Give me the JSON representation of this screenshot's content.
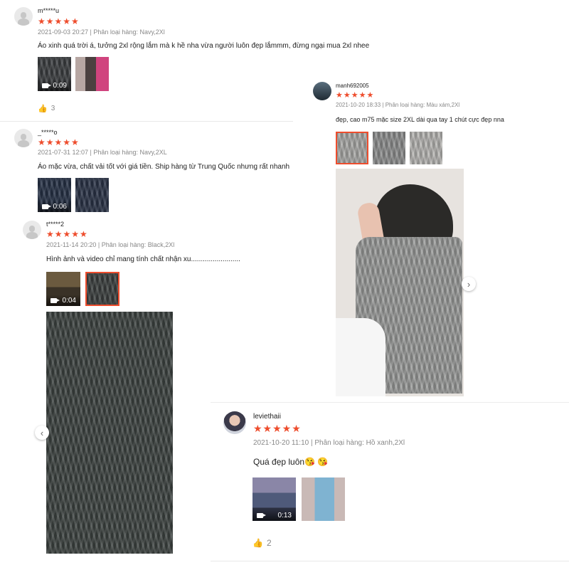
{
  "reviews": [
    {
      "username": "m*****u",
      "stars": "★★★★★",
      "meta": "2021-09-03 20:27 | Phân loại hàng: Navy,2Xl",
      "content": "Áo xinh quá trời á, tưởng 2xl rộng lắm mà k hề nha vừa người luôn đẹp lắmmm, đừng ngại mua 2xl nhee",
      "media": [
        {
          "type": "video",
          "duration": "0:09"
        },
        {
          "type": "image"
        }
      ],
      "likes": "3"
    },
    {
      "username": "_*****o",
      "stars": "★★★★★",
      "meta": "2021-07-31 12:07 | Phân loại hàng: Navy,2XL",
      "content": "Áo mặc vừa, chất vải tốt với giá tiền. Ship hàng từ Trung Quốc nhưng rất nhanh",
      "media": [
        {
          "type": "video",
          "duration": "0:06"
        },
        {
          "type": "image"
        }
      ]
    },
    {
      "username": "t*****2",
      "stars": "★★★★★",
      "meta": "2021-11-14 20:20 | Phân loại hàng: Black,2Xl",
      "content": "Hình ảnh và video chỉ mang tính chất nhận xu.........................",
      "media": [
        {
          "type": "video",
          "duration": "0:04"
        },
        {
          "type": "image",
          "selected": true
        }
      ]
    },
    {
      "username": "manh692005",
      "stars": "★★★★★",
      "meta": "2021-10-20 18:33 | Phân loại hàng: Màu xám,2Xl",
      "content": "đẹp, cao m75 mặc size 2XL dài qua tay 1 chút cực đẹp nna",
      "media": [
        {
          "type": "image",
          "selected": true
        },
        {
          "type": "image"
        },
        {
          "type": "image"
        }
      ]
    },
    {
      "username": "leviethaii",
      "stars": "★★★★★",
      "meta": "2021-10-20 11:10 | Phân loại hàng: Hồ xanh,2Xl",
      "content": "Quá đẹp luôn😘 😘",
      "media": [
        {
          "type": "video",
          "duration": "0:13"
        },
        {
          "type": "image"
        }
      ],
      "likes": "2"
    }
  ],
  "icons": {
    "star": "star-icon",
    "like": "thumbs-up-icon",
    "video": "video-camera-icon",
    "prev": "chevron-left-icon",
    "next": "chevron-right-icon"
  },
  "colors": {
    "accent": "#ee4d2d",
    "meta": "#888888"
  }
}
